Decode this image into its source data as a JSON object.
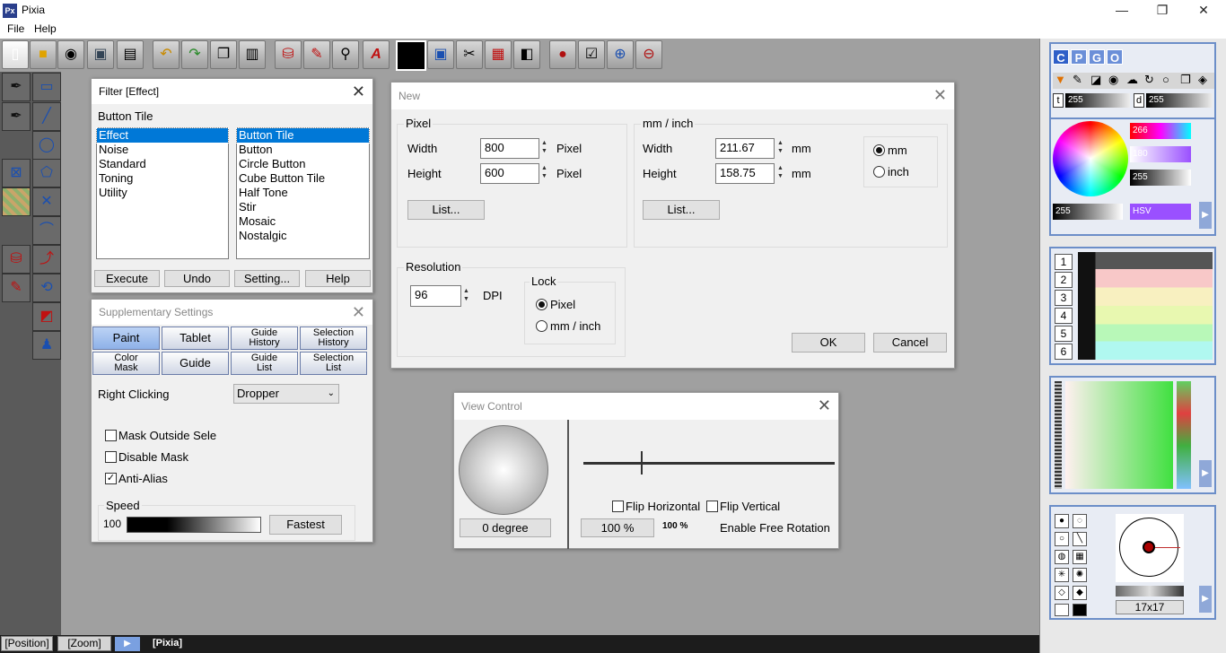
{
  "app": {
    "title": "Pixia",
    "icon": "pixia-logo-icon"
  },
  "window_controls": {
    "minimize": "—",
    "restore": "❐",
    "close": "✕"
  },
  "menu": [
    {
      "label": "File"
    },
    {
      "label": "Help"
    }
  ],
  "toolbar": {
    "icons": [
      "new-file-icon",
      "open-folder-icon",
      "camera-icon",
      "save-disk-icon",
      "print-icon",
      "undo-icon",
      "redo-icon",
      "copy-icon",
      "paste-icon",
      "paint-bucket-icon",
      "brush-icon",
      "zoom-icon",
      "text-icon",
      "color-swatch-icon",
      "image-icon",
      "lasso-icon",
      "layers-icon",
      "stamp-icon",
      "sphere-icon",
      "checklist-icon",
      "zoom-in-icon",
      "zoom-out-icon"
    ]
  },
  "toolbox": {
    "icons": [
      "pen-icon",
      "rectangle-icon",
      "pen-alt-icon",
      "line-icon",
      "circle-icon",
      "crop-icon",
      "polygon-icon",
      "grid-icon",
      "cross-icon",
      "curve-icon",
      "fill-bucket-icon",
      "path-icon",
      "fill-bucket-alt-icon",
      "transform-icon",
      "select-point-icon",
      "smudge-icon"
    ]
  },
  "filter_dialog": {
    "title": "Filter [Effect]",
    "subtitle": "Button Tile",
    "categories": [
      "Effect",
      "Noise",
      "Standard",
      "Toning",
      "Utility"
    ],
    "selected_category": 0,
    "filters": [
      "Button Tile",
      "Button",
      "Circle Button",
      "Cube Button Tile",
      "Half Tone",
      "Stir",
      "Mosaic",
      "Nostalgic"
    ],
    "selected_filter": 0,
    "buttons": {
      "execute": "Execute",
      "undo": "Undo",
      "setting": "Setting...",
      "help": "Help"
    }
  },
  "supplementary": {
    "title": "Supplementary Settings",
    "tabs_row1": [
      "Paint",
      "Tablet",
      "Guide\nHistory",
      "Selection\nHistory"
    ],
    "tabs_row2": [
      "Color\nMask",
      "Guide",
      "Guide\nList",
      "Selection\nList"
    ],
    "right_clicking_label": "Right Clicking",
    "right_clicking_value": "Dropper",
    "mask_outside": "Mask Outside Sele",
    "disable_mask": "Disable Mask",
    "anti_alias": "Anti-Alias",
    "speed_label": "Speed",
    "speed_value": "100",
    "fastest": "Fastest"
  },
  "new_dialog": {
    "title": "New",
    "pixel_group": "Pixel",
    "width_label": "Width",
    "height_label": "Height",
    "width_px": "800",
    "height_px": "600",
    "pixel_unit": "Pixel",
    "list_label": "List...",
    "mm_group": "mm / inch",
    "width_mm": "211.67",
    "height_mm": "158.75",
    "mm_unit": "mm",
    "mm_radio": "mm",
    "inch_radio": "inch",
    "resolution_group": "Resolution",
    "dpi_value": "96",
    "dpi_label": "DPI",
    "lock_group": "Lock",
    "lock_pixel": "Pixel",
    "lock_mm": "mm / inch",
    "ok": "OK",
    "cancel": "Cancel"
  },
  "view_control": {
    "title": "View Control",
    "degree": "0 degree",
    "flip_h": "Flip Horizontal",
    "flip_v": "Flip Vertical",
    "zoom_btn": "100 %",
    "zoom_text": "100 %",
    "free_rotation": "Enable Free Rotation"
  },
  "right_panel": {
    "mode_tabs": [
      "C",
      "P",
      "G",
      "O"
    ],
    "t_label": "t",
    "t_value": "255",
    "d_label": "d",
    "d_value": "255",
    "hsv_values": [
      "266",
      "180",
      "255"
    ],
    "alpha_value": "255",
    "hsv_label": "HSV",
    "palette_rows": [
      "1",
      "2",
      "3",
      "4",
      "5",
      "6"
    ],
    "brush_size": "17x17"
  },
  "statusbar": {
    "position": "[Position]",
    "zoom": "[Zoom]",
    "doc": "[Pixia]"
  }
}
